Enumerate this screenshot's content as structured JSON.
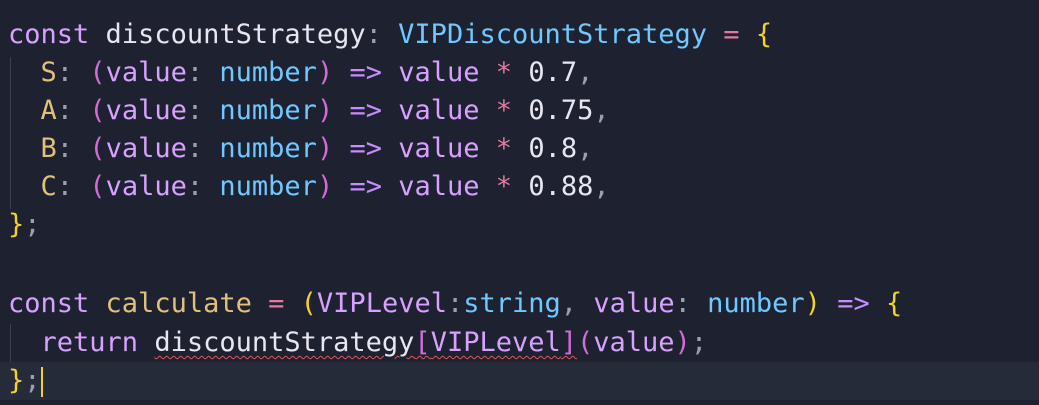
{
  "code": {
    "line1": {
      "kw_const": "const",
      "name": "discountStrategy",
      "colon": ":",
      "type": "VIPDiscountStrategy",
      "eq": "=",
      "open_brace": "{"
    },
    "entries": [
      {
        "key": "S",
        "factor": "0.7"
      },
      {
        "key": "A",
        "factor": "0.75"
      },
      {
        "key": "B",
        "factor": "0.8"
      },
      {
        "key": "C",
        "factor": "0.88"
      }
    ],
    "entry_tokens": {
      "colon": ":",
      "open_paren": "(",
      "param": "value",
      "param_colon": ":",
      "param_type": "number",
      "close_paren": ")",
      "arrow": "=>",
      "value": "value",
      "mul": "*",
      "comma": ","
    },
    "close1": {
      "brace": "}",
      "semi": ";"
    },
    "line6": {
      "kw_const": "const",
      "name": "calculate",
      "eq": "=",
      "open_paren": "(",
      "param1": "VIPLevel",
      "colon1": ":",
      "type1": "string",
      "comma": ",",
      "param2": "value",
      "colon2": ":",
      "type2": "number",
      "close_paren": ")",
      "arrow": "=>",
      "open_brace": "{"
    },
    "line7": {
      "kw_return": "return",
      "obj": "discountStrategy",
      "open_bracket": "[",
      "index": "VIPLevel",
      "close_bracket": "]",
      "open_paren": "(",
      "arg": "value",
      "close_paren": ")",
      "semi": ";"
    },
    "close2": {
      "brace": "}",
      "semi": ";"
    }
  },
  "colors": {
    "background": "#1e2230",
    "keyword": "#d8a0ff",
    "type": "#6fc8ff",
    "property": "#e2c07a",
    "brace": "#f2d12c",
    "error_squiggle": "#e05555"
  }
}
